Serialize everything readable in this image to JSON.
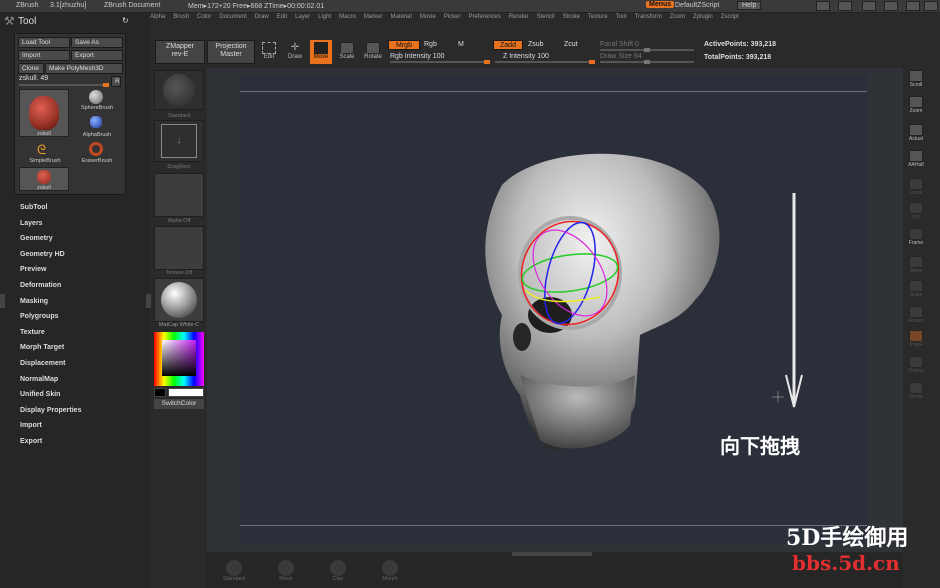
{
  "topbar": {
    "app": "ZBrush",
    "version": "3.1[zhuzhu]",
    "document": "ZBrush Document",
    "mem": "Mem▸172+20 Free▸668 ZTime▸00:00:02.01",
    "menus": "Menus",
    "script": "DefaultZScript",
    "help": "Help"
  },
  "menubar": [
    "Alpha",
    "Brush",
    "Color",
    "Document",
    "Draw",
    "Edit",
    "Layer",
    "Light",
    "Macro",
    "Marker",
    "Material",
    "Movie",
    "Picker",
    "Preferences",
    "Render",
    "Stencil",
    "Stroke",
    "Texture",
    "Tool",
    "Transform",
    "Zoom",
    "Zplugin",
    "Zscript"
  ],
  "tool": {
    "title": "Tool",
    "load": "Load Tool",
    "save": "Save As",
    "import": "Import",
    "export": "Export",
    "clone": "Clone",
    "polymesh": "Make PolyMesh3D",
    "current": "zskull. 49",
    "r": "R",
    "thumbs": {
      "zskull": "zskull",
      "sphere": "SphereBrush",
      "alpha": "AlphaBrush",
      "simple": "SimpleBrush",
      "eraser": "EraserBrush",
      "zskull2": "zskull"
    }
  },
  "sidelist": [
    "SubTool",
    "Layers",
    "Geometry",
    "Geometry HD",
    "Preview",
    "Deformation",
    "Masking",
    "Polygroups",
    "Texture",
    "Morph Target",
    "Displacement",
    "NormalMap",
    "Unified Skin",
    "Display Properties",
    "Import",
    "Export"
  ],
  "col2": {
    "brush": "Standard",
    "stroke": "DragRect",
    "alpha": "Alpha Off",
    "texture": "Texture Off",
    "matcap": "MatCap White C",
    "switch": "SwitchColor"
  },
  "toolbar": {
    "zmapper": "ZMapper",
    "zmapper2": "rev-E",
    "projection": "Projection",
    "projection2": "Master",
    "edit": "Edit",
    "draw": "Draw",
    "move": "Move",
    "scale": "Scale",
    "rotate": "Rotate",
    "mrgb": "Mrgb",
    "rgb": "Rgb",
    "m": "M",
    "rgbint": "Rgb Intensity 100",
    "zadd": "Zadd",
    "zsub": "Zsub",
    "zcut": "Zcut",
    "zint": "Z Intensity 100",
    "focal": "Focal Shift 0",
    "drawsize": "Draw Size 64",
    "active": "ActivePoints: 393,218",
    "total": "TotalPoints: 393,218"
  },
  "rightbar": [
    "Scroll",
    "Zoom",
    "Actual",
    "AAHalf",
    "Local",
    "Xyz",
    "Frame",
    "Move",
    "Scale",
    "Rotate",
    "PolyF",
    "Transp",
    "Ghost"
  ],
  "bottombar": [
    "Standard",
    "Move",
    "Clay",
    "Morph"
  ],
  "overlay": {
    "drag": "向下拖拽",
    "wm1": "5D手绘御用",
    "wm2": "bbs.5d.cn"
  }
}
